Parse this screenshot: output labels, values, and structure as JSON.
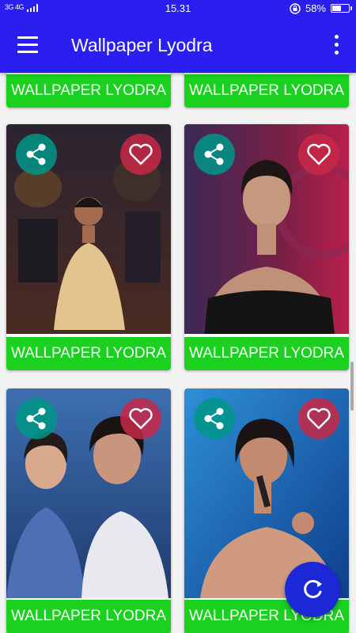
{
  "status_bar": {
    "network": "3G 4G",
    "time": "15.31",
    "battery": "58%",
    "battery_level": 0.58
  },
  "app_bar": {
    "title": "Wallpaper Lyodra",
    "menu_icon": "hamburger-menu-icon",
    "overflow_icon": "more-vert-icon"
  },
  "cards": [
    {
      "label": "WALLPAPER LYODRA"
    },
    {
      "label": "WALLPAPER LYODRA"
    },
    {
      "label": "WALLPAPER LYODRA",
      "share_icon": "share-icon",
      "favorite_icon": "heart-outline-icon"
    },
    {
      "label": "WALLPAPER LYODRA",
      "share_icon": "share-icon",
      "favorite_icon": "heart-outline-icon"
    },
    {
      "label": "WALLPAPER LYODRA",
      "share_icon": "share-icon",
      "favorite_icon": "heart-outline-icon"
    },
    {
      "label": "WALLPAPER LYODRA",
      "share_icon": "share-icon",
      "favorite_icon": "heart-outline-icon"
    }
  ],
  "fab": {
    "icon": "refresh-icon"
  },
  "colors": {
    "primary": "#2a1ef0",
    "label_green": "#19d11e",
    "fab": "#1c27d6",
    "share": "#009688",
    "favorite": "#c82846"
  }
}
